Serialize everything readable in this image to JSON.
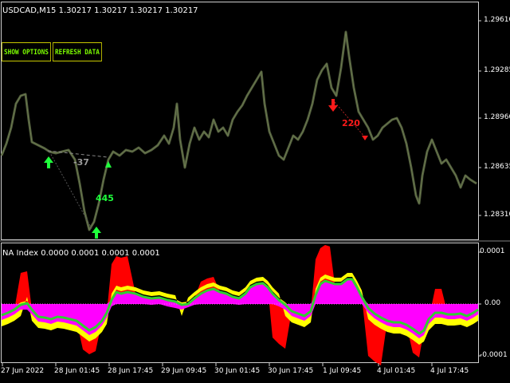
{
  "main_chart": {
    "header": "USDCAD,M15  1.30217 1.30217 1.30217 1.30217",
    "price_labels": [
      "1.29610",
      "1.29285",
      "1.28960",
      "1.28635",
      "1.28310"
    ],
    "annotations": {
      "gray_value": "-37",
      "green_value": "445",
      "red_value": "220"
    }
  },
  "buttons": {
    "show_options": "SHOW OPTIONS",
    "refresh_data": "REFRESH DATA"
  },
  "indicator": {
    "header": "NA Index 0.0000 0.0001 0.0001 0.0001",
    "scale_labels": [
      "0.0001",
      "0.00",
      "-0.0001"
    ]
  },
  "time_axis": [
    "27 Jun 2022",
    "28 Jun 01:45",
    "28 Jun 17:45",
    "29 Jun 09:45",
    "30 Jun 01:45",
    "30 Jun 17:45",
    "1 Jul 09:45",
    "4 Jul 01:45",
    "4 Jul 17:45"
  ],
  "colors": {
    "frame": "#ffffff",
    "candles": "#4f5a3c",
    "buy_arrow": "#1fff3c",
    "sell_arrow": "#ff1a1a",
    "zero_band": "#ff00ff",
    "yellow_band": "#ffff00",
    "red_band": "#ff0000",
    "signal_line": "#32cd32"
  }
}
